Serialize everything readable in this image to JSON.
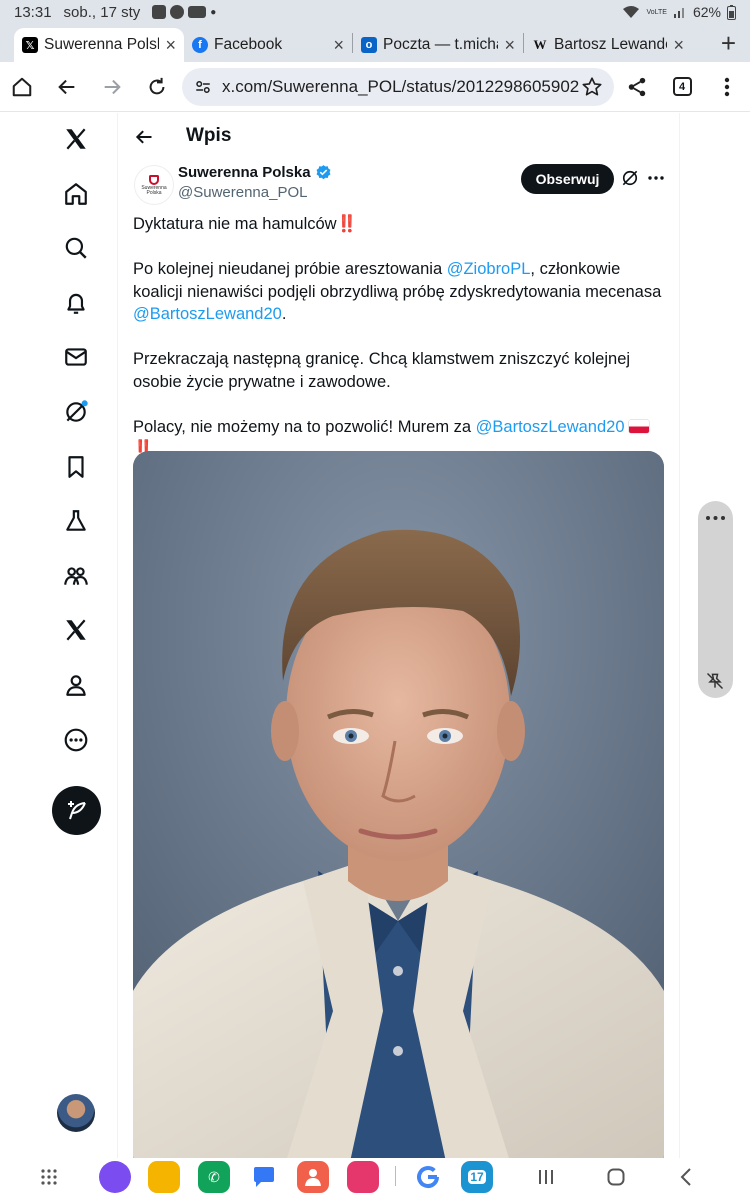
{
  "status_bar": {
    "time": "13:31",
    "date": "sob., 17 sty",
    "battery": "62%"
  },
  "tabs": [
    {
      "label": "Suwerenna Polska",
      "favicon": "x-logo",
      "active": true
    },
    {
      "label": "Facebook",
      "favicon": "facebook-logo",
      "active": false
    },
    {
      "label": "Poczta — t.michal",
      "favicon": "outlook-logo",
      "active": false
    },
    {
      "label": "Bartosz Lewandowski",
      "favicon": "wikipedia-logo",
      "active": false
    }
  ],
  "browser": {
    "url": "x.com/Suwerenna_POL/status/2012298605902",
    "tab_count": "4"
  },
  "header": {
    "title": "Wpis"
  },
  "author": {
    "name": "Suwerenna Polska",
    "handle": "@Suwerenna_POL",
    "logo_text": "Suwerenna Polska"
  },
  "follow_label": "Obserwuj",
  "tweet": {
    "line1_text": "Dyktatura nie ma hamulców",
    "bangs": "‼️",
    "p2_a": "Po kolejnej nieudanej próbie aresztowania ",
    "p2_mention1": "@ZiobroPL",
    "p2_b": ", członkowie koalicji nienawiści podjęli obrzydliwą próbę zdyskredytowania mecenasa ",
    "p2_mention2": "@BartoszLewand20",
    "p2_c": ".",
    "p3": "Przekraczają następną granicę. Chcą klamstwem zniszczyć kolejnej osobie życie prywatne i zawodowe.",
    "p4_a": "Polacy, nie możemy na to pozwolić! Murem za ",
    "p4_mention": "@BartoszLewand20"
  },
  "colors": {
    "accent": "#1d9bf0",
    "text": "#0f1419",
    "muted": "#536471",
    "bangs_red": "#d0021b"
  },
  "dock_icon_calendar": "17"
}
